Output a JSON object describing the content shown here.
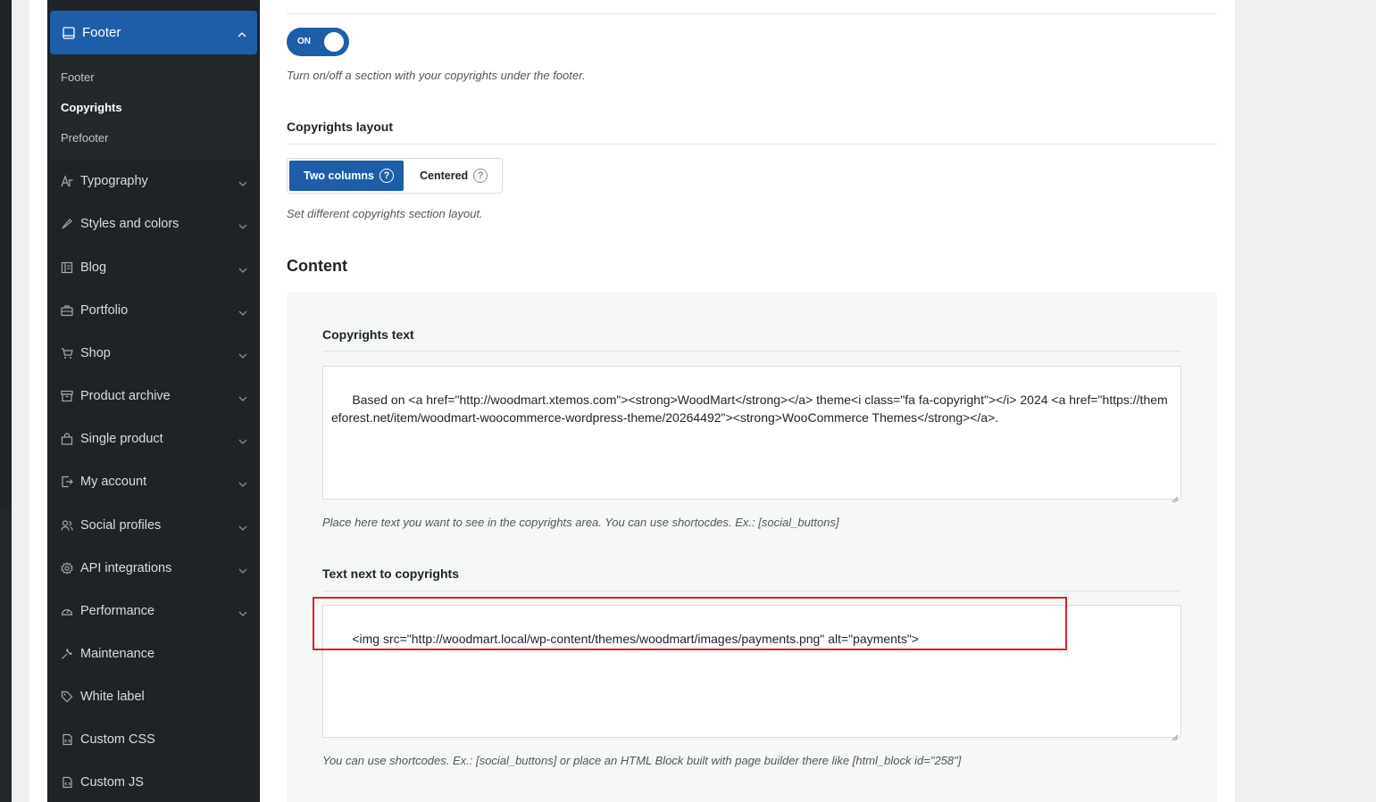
{
  "sidebar": {
    "active": {
      "label": "Footer",
      "icon": "footer-icon"
    },
    "sub_items": [
      {
        "label": "Footer"
      },
      {
        "label": "Copyrights"
      },
      {
        "label": "Prefooter"
      }
    ],
    "items": [
      {
        "label": "Typography",
        "icon": "typography-icon"
      },
      {
        "label": "Styles and colors",
        "icon": "brush-icon"
      },
      {
        "label": "Blog",
        "icon": "blog-icon"
      },
      {
        "label": "Portfolio",
        "icon": "briefcase-icon"
      },
      {
        "label": "Shop",
        "icon": "cart-icon"
      },
      {
        "label": "Product archive",
        "icon": "archive-icon"
      },
      {
        "label": "Single product",
        "icon": "bag-icon"
      },
      {
        "label": "My account",
        "icon": "account-icon"
      },
      {
        "label": "Social profiles",
        "icon": "users-icon"
      },
      {
        "label": "API integrations",
        "icon": "gear-icon"
      },
      {
        "label": "Performance",
        "icon": "gauge-icon"
      },
      {
        "label": "Maintenance",
        "icon": "wrench-icon"
      },
      {
        "label": "White label",
        "icon": "tag-icon"
      },
      {
        "label": "Custom CSS",
        "icon": "css-icon"
      },
      {
        "label": "Custom JS",
        "icon": "js-icon"
      }
    ]
  },
  "copyrights": {
    "toggle_label": "ON",
    "toggle_desc": "Turn on/off a section with your copyrights under the footer."
  },
  "layout": {
    "title": "Copyrights layout",
    "options": [
      "Two columns",
      "Centered"
    ],
    "selected": "Two columns",
    "desc": "Set different copyrights section layout."
  },
  "content": {
    "title": "Content",
    "copyrights_text": {
      "title": "Copyrights text",
      "value": "Based on <a href=\"http://woodmart.xtemos.com\"><strong>WoodMart</strong></a> theme<i class=\"fa fa-copyright\"></i> 2024 <a href=\"https://themeforest.net/item/woodmart-woocommerce-wordpress-theme/20264492\"><strong>WooCommerce Themes</strong></a>.",
      "desc": "Place here text you want to see in the copyrights area. You can use shortocdes. Ex.: [social_buttons]"
    },
    "text_next": {
      "title": "Text next to copyrights",
      "value": "<img src=\"http://woodmart.local/wp-content/themes/woodmart/images/payments.png\" alt=\"payments\">",
      "desc": "You can use shortcodes. Ex.: [social_buttons] or place an HTML Block built with page builder there like [html_block id=\"258\"]"
    }
  },
  "colors": {
    "accent": "#1e5ea8",
    "sidebar_bg": "#1d2327",
    "highlight": "#e0202a"
  }
}
